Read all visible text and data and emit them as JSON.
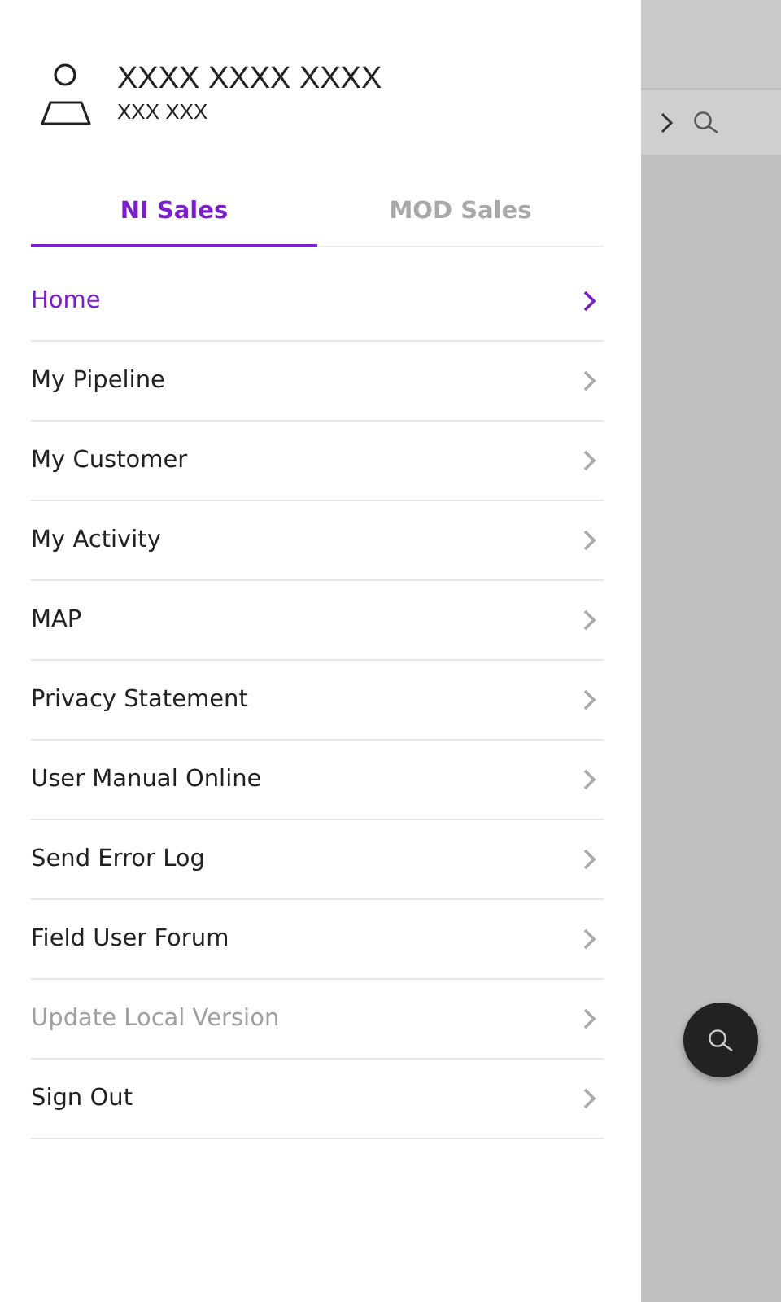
{
  "user": {
    "name": "XXXX XXXX XXXX",
    "subtitle": "XXX XXX"
  },
  "tabs": [
    {
      "label": "NI Sales",
      "selected": true
    },
    {
      "label": "MOD Sales",
      "selected": false
    }
  ],
  "menu": [
    {
      "label": "Home",
      "selected": true,
      "disabled": false
    },
    {
      "label": "My Pipeline",
      "selected": false,
      "disabled": false
    },
    {
      "label": "My Customer",
      "selected": false,
      "disabled": false
    },
    {
      "label": "My Activity",
      "selected": false,
      "disabled": false
    },
    {
      "label": "MAP",
      "selected": false,
      "disabled": false
    },
    {
      "label": "Privacy Statement",
      "selected": false,
      "disabled": false
    },
    {
      "label": "User Manual Online",
      "selected": false,
      "disabled": false
    },
    {
      "label": "Send Error Log",
      "selected": false,
      "disabled": false
    },
    {
      "label": "Field User Forum",
      "selected": false,
      "disabled": false
    },
    {
      "label": "Update Local Version",
      "selected": false,
      "disabled": true
    },
    {
      "label": "Sign Out",
      "selected": false,
      "disabled": false
    }
  ]
}
